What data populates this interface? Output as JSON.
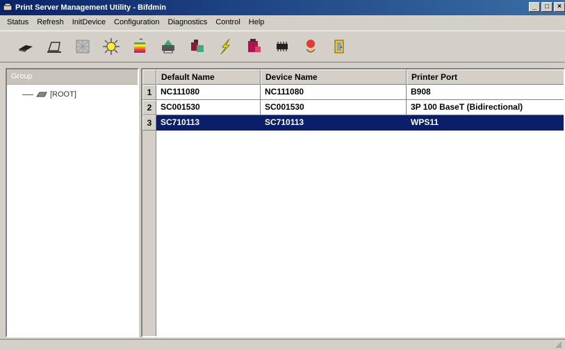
{
  "window": {
    "title": "Print Server Management Utility - Bifdmin",
    "minimize": "_",
    "maximize": "□",
    "close": "×"
  },
  "menu": [
    {
      "label": "Status"
    },
    {
      "label": "Refresh"
    },
    {
      "label": "InitDevice"
    },
    {
      "label": "Configuration"
    },
    {
      "label": "Diagnostics"
    },
    {
      "label": "Control"
    },
    {
      "label": "Help"
    }
  ],
  "toolbar": [
    {
      "icon": "eraser-icon"
    },
    {
      "icon": "printer-outline-icon"
    },
    {
      "icon": "grid-disabled-icon"
    },
    {
      "icon": "network-hub-icon"
    },
    {
      "icon": "apple-icon"
    },
    {
      "icon": "printer-color-icon"
    },
    {
      "icon": "device-config-icon"
    },
    {
      "icon": "lightning-icon"
    },
    {
      "icon": "printer-red-icon"
    },
    {
      "icon": "chip-icon"
    },
    {
      "icon": "upgrade-icon"
    },
    {
      "icon": "exit-door-icon"
    }
  ],
  "sidebar": {
    "header": "Group",
    "root_label": "[ROOT]"
  },
  "table": {
    "columns": [
      "Default Name",
      "Device Name",
      "Printer Port"
    ],
    "rows": [
      {
        "num": "1",
        "default_name": "NC111080",
        "device_name": "NC111080",
        "port": "B908"
      },
      {
        "num": "2",
        "default_name": "SC001530",
        "device_name": "SC001530",
        "port": "3P 100 BaseT (Bidirectional)"
      },
      {
        "num": "3",
        "default_name": "SC710113",
        "device_name": "SC710113",
        "port": "WPS11"
      }
    ],
    "selected_row": 3
  },
  "colors": {
    "title_bar": "#0a246a",
    "selection": "#0a1e6a",
    "face": "#d4d0c8"
  }
}
